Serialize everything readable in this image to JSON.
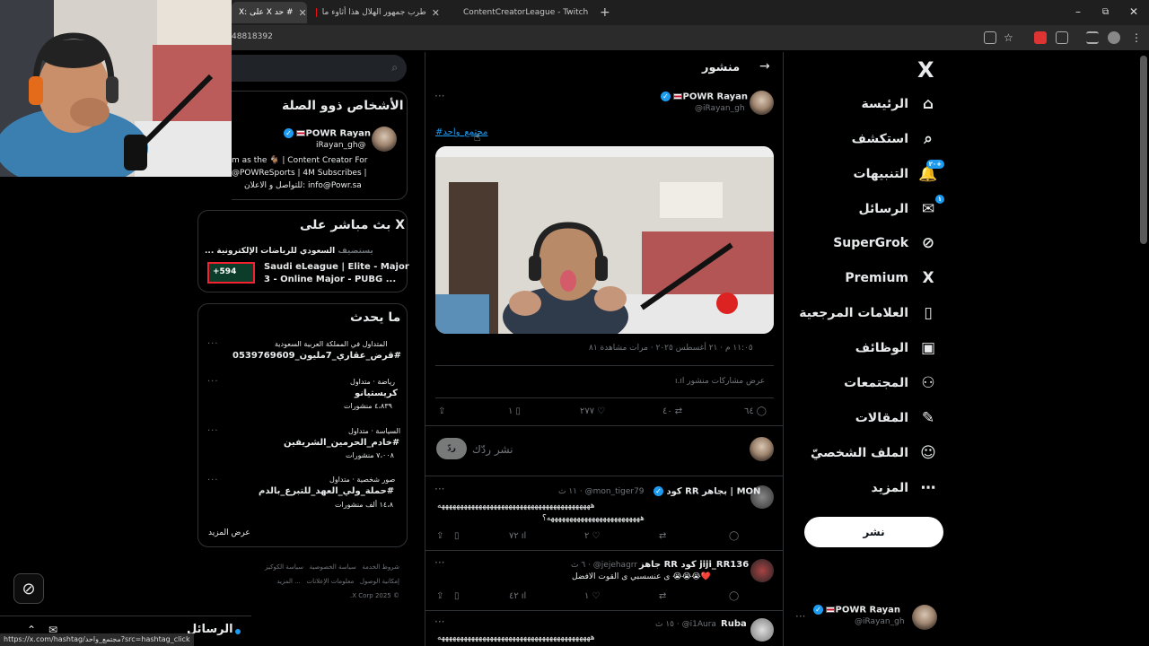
{
  "browser": {
    "tabs": [
      {
        "label": "X: على X حد #",
        "active": true
      },
      {
        "label": "طرب جمهور الهلال  هذا  أثاوء ما",
        "active": false
      },
      {
        "label": "ContentCreatorLeague - Twitch",
        "active": false
      }
    ],
    "new_tab": "+",
    "url": "48818392",
    "status_url": "https://x.com/hashtag/مجتمع_واحد?src=hashtag_click",
    "window_controls": {
      "minimize": "–",
      "restore": "⧉",
      "close": "✕"
    }
  },
  "nav": {
    "items": [
      {
        "label": "الرئيسة",
        "icon": "home-icon",
        "glyph": "⌂"
      },
      {
        "label": "استكشف",
        "icon": "search-icon",
        "glyph": "⌕"
      },
      {
        "label": "التنبيهات",
        "icon": "bell-icon",
        "glyph": "🔔",
        "badge": "+٢٠"
      },
      {
        "label": "الرسائل",
        "icon": "mail-icon",
        "glyph": "✉",
        "badge": "١"
      },
      {
        "label": "SuperGrok",
        "icon": "grok-icon",
        "glyph": "⊘"
      },
      {
        "label": "Premium",
        "icon": "x-premium-icon",
        "glyph": "X"
      },
      {
        "label": "العلامات المرجعية",
        "icon": "bookmark-icon",
        "glyph": "▯"
      },
      {
        "label": "الوظائف",
        "icon": "briefcase-icon",
        "glyph": "▣"
      },
      {
        "label": "المجتمعات",
        "icon": "communities-icon",
        "glyph": "⚇"
      },
      {
        "label": "المقالات",
        "icon": "articles-icon",
        "glyph": "✎"
      },
      {
        "label": "الملف الشخصيّ",
        "icon": "profile-icon",
        "glyph": "☺"
      },
      {
        "label": "المزيد",
        "icon": "more-icon",
        "glyph": "⋯"
      }
    ],
    "post_button": "نشر",
    "account": {
      "name": "POWR Rayan",
      "handle": "@iRayan_gh"
    }
  },
  "post": {
    "header_title": "منشور",
    "author_name": "POWR Rayan",
    "author_handle": "@iRayan_gh",
    "hashtag": "#مجتمع_واحد",
    "meta": "١١:٠٥ م · ٢١ أغسطس ٢٠٢٥ · مرات مشاهدة ٨١",
    "view_engagements": "عرض مشاركات منشور",
    "stats": {
      "replies": "٦٤",
      "reposts": "٤٠",
      "likes": "٢٧٧",
      "bookmarks": "١"
    },
    "reply_placeholder": "نشر ردّك",
    "reply_button": "ردّ"
  },
  "replies": [
    {
      "name": "كود RR بجاهر | MON",
      "handle": "@mon_tiger79",
      "time": "١١ ث",
      "line1": "هههههههههههههههههههههههههههههههههههههههههه",
      "line2": "هههههههههههههههههههههههههه؟",
      "likes": "٢",
      "views": "٧٢"
    },
    {
      "name": "جاهز RR كود jiji_RR136",
      "handle": "@jejehagrr",
      "time": "٦ ث",
      "line1": "ى عنسسبي ى القوت الافضل 😭😭😭❤️",
      "line2": "",
      "likes": "١",
      "views": "٤٢"
    },
    {
      "name": "Ruba",
      "handle": "@i1Aura",
      "time": "١٥ ث",
      "line1": "هههههههههههههههههههههههههههههههههههههههههه",
      "line2": "",
      "likes": "",
      "views": ""
    }
  ],
  "sidebar": {
    "relevant_title": "الأشخاص ذوو الصلة",
    "relevant_user": {
      "name": "POWR Rayan",
      "handle": "@iRayan_gh",
      "bio1": "m as the 🐐 | Content Creator For",
      "bio2": "@POWReSports | 4M Subscribes |",
      "bio3": "للتواصل و الاعلان: info@Powr.sa"
    },
    "live_title": "X بث مباشر على",
    "live_host": "السعودي للرياضات الإلكترونية ...",
    "live_host_label": "يستضيف",
    "live_event1": "Saudi eLeague | Elite - Major",
    "live_event2": "3 - Online Major - PUBG ...",
    "live_count": "+594",
    "trends_title": "ما يحدث",
    "trends": [
      {
        "context": "المتداول في المملكة العربية السعودية",
        "name": "#قرض_عقاري_7مليون_0539769609",
        "posts": ""
      },
      {
        "context": "رياضة · متداول",
        "name": "كريستيانو",
        "posts": "٤،٨٣٩ منشورات"
      },
      {
        "context": "السياسة · متداول",
        "name": "#خادم_الحرمين_الشريفين",
        "posts": "٧،٠٠٨ منشورات"
      },
      {
        "context": "صور شخصية · متداول",
        "name": "#حملة_ولي_العهد_للتبرع_بالدم",
        "posts": "١٤،٨ ألف منشورات"
      }
    ],
    "show_more": "عرض المزيد",
    "footer": [
      "شروط الخدمة",
      "سياسة الخصوصية",
      "سياسة الكوكيز",
      "إمكانية الوصول",
      "معلومات الإعلانات",
      "... المزيد",
      "© 2025 X Corp."
    ]
  },
  "messages_bar": {
    "label": "الرسائل"
  },
  "colors": {
    "accent": "#1d9bf0",
    "bg": "#000000",
    "border": "#2f3336",
    "muted": "#71767b"
  }
}
